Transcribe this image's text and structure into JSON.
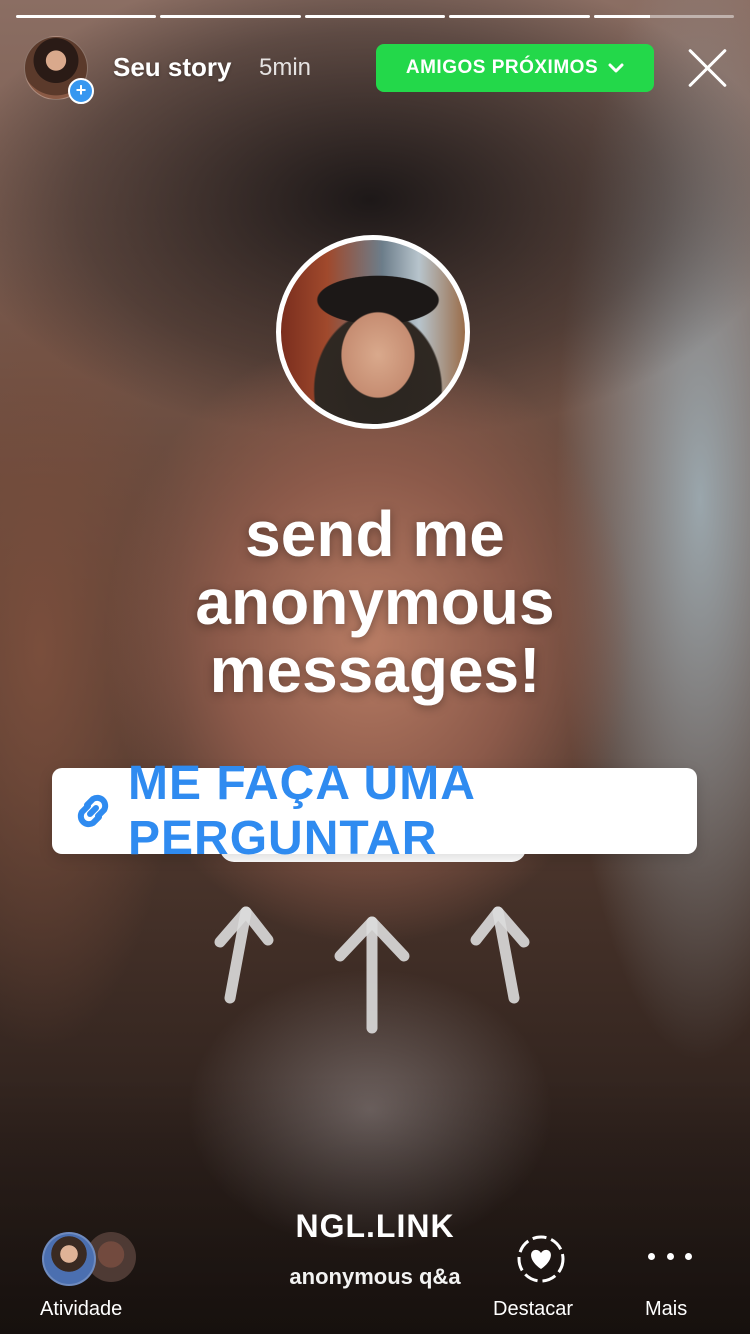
{
  "story": {
    "title": "Seu story",
    "time": "5min",
    "progress_segments": [
      1,
      1,
      1,
      1,
      0.4
    ]
  },
  "header": {
    "close_friends_label": "AMIGOS PRÓXIMOS"
  },
  "content": {
    "headline_lines": [
      "send me",
      "anonymous",
      "messages!"
    ],
    "link_sticker_label": "ME FAÇA UMA PERGUNTAR"
  },
  "footer": {
    "activity_label": "Atividade",
    "ngl_title": "NGL.LINK",
    "ngl_subtitle": "anonymous q&a",
    "highlight_label": "Destacar",
    "more_label": "Mais"
  },
  "colors": {
    "accent_green": "#23d84a",
    "link_blue": "#2f8bf0",
    "plus_blue": "#3797f0"
  },
  "icons": [
    "plus-icon",
    "chevron-down-icon",
    "close-icon",
    "link-icon",
    "arrow-up-icon",
    "heart-highlight-icon",
    "more-dots-icon"
  ]
}
